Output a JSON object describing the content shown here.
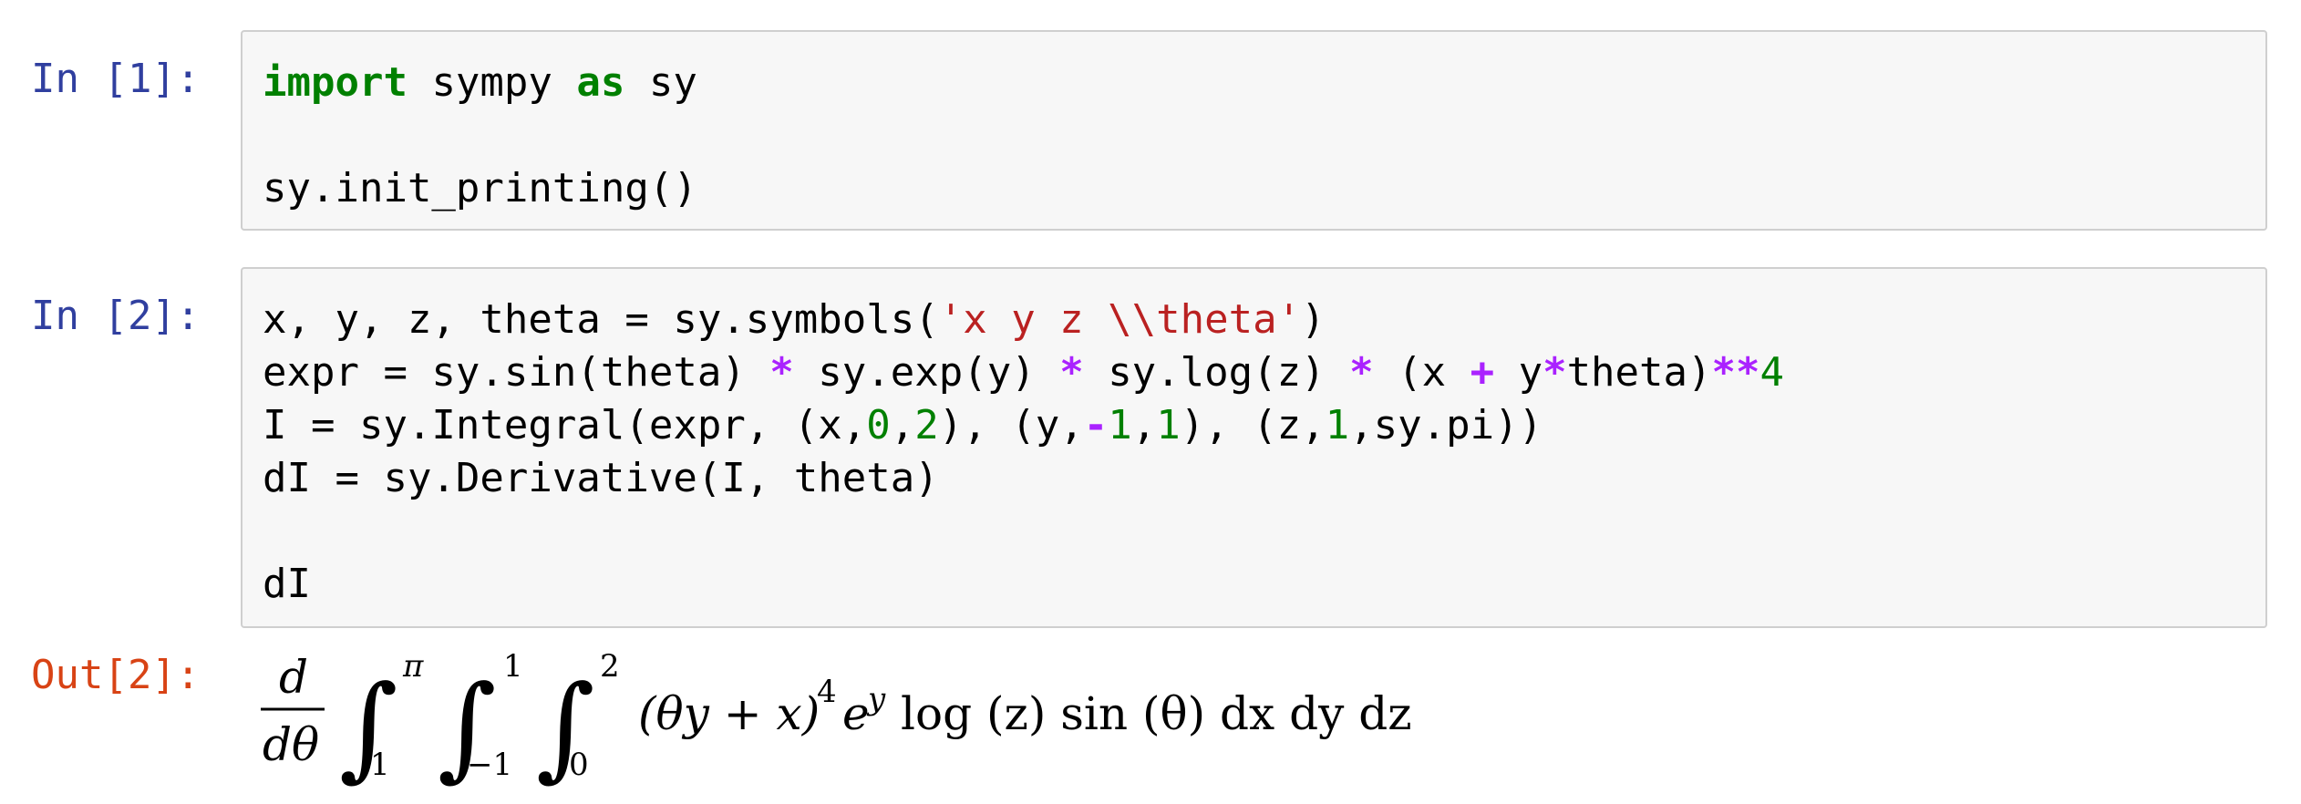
{
  "cells": [
    {
      "prompt": "In [1]:",
      "lines": [
        [
          {
            "t": "import",
            "c": "kw"
          },
          {
            "t": " sympy ",
            "c": ""
          },
          {
            "t": "as",
            "c": "kw"
          },
          {
            "t": " sy",
            "c": ""
          }
        ],
        [],
        [
          {
            "t": "sy.init_printing()",
            "c": ""
          }
        ]
      ]
    },
    {
      "prompt": "In [2]:",
      "lines": [
        [
          {
            "t": "x, y, z, theta = sy.symbols(",
            "c": ""
          },
          {
            "t": "'x y z \\\\theta'",
            "c": "str"
          },
          {
            "t": ")",
            "c": ""
          }
        ],
        [
          {
            "t": "expr = sy.sin(theta) ",
            "c": ""
          },
          {
            "t": "*",
            "c": "op"
          },
          {
            "t": " sy.exp(y) ",
            "c": ""
          },
          {
            "t": "*",
            "c": "op"
          },
          {
            "t": " sy.log(z) ",
            "c": ""
          },
          {
            "t": "*",
            "c": "op"
          },
          {
            "t": " (x ",
            "c": ""
          },
          {
            "t": "+",
            "c": "op"
          },
          {
            "t": " y",
            "c": ""
          },
          {
            "t": "*",
            "c": "op"
          },
          {
            "t": "theta)",
            "c": ""
          },
          {
            "t": "**",
            "c": "op"
          },
          {
            "t": "4",
            "c": "num"
          }
        ],
        [
          {
            "t": "I = sy.Integral(expr, (x,",
            "c": ""
          },
          {
            "t": "0",
            "c": "num"
          },
          {
            "t": ",",
            "c": ""
          },
          {
            "t": "2",
            "c": "num"
          },
          {
            "t": "), (y,",
            "c": ""
          },
          {
            "t": "-",
            "c": "op"
          },
          {
            "t": "1",
            "c": "num"
          },
          {
            "t": ",",
            "c": ""
          },
          {
            "t": "1",
            "c": "num"
          },
          {
            "t": "), (z,",
            "c": ""
          },
          {
            "t": "1",
            "c": "num"
          },
          {
            "t": ",sy.pi))",
            "c": ""
          }
        ],
        [
          {
            "t": "dI = sy.Derivative(I, theta)",
            "c": ""
          }
        ],
        [],
        [
          {
            "t": "dI",
            "c": ""
          }
        ]
      ]
    }
  ],
  "output": {
    "prompt": "Out[2]:",
    "d_num": "d",
    "d_den": "dθ",
    "integral_sign": "∫",
    "limits": [
      {
        "upper": "π",
        "lower": "1"
      },
      {
        "upper": "1",
        "lower": "−1"
      },
      {
        "upper": "2",
        "lower": "0"
      }
    ],
    "integrand_base": "(θy + x)",
    "power": "4",
    "e": "e",
    "e_power": "y",
    "rest": "log (z) sin (θ) dx dy dz"
  }
}
